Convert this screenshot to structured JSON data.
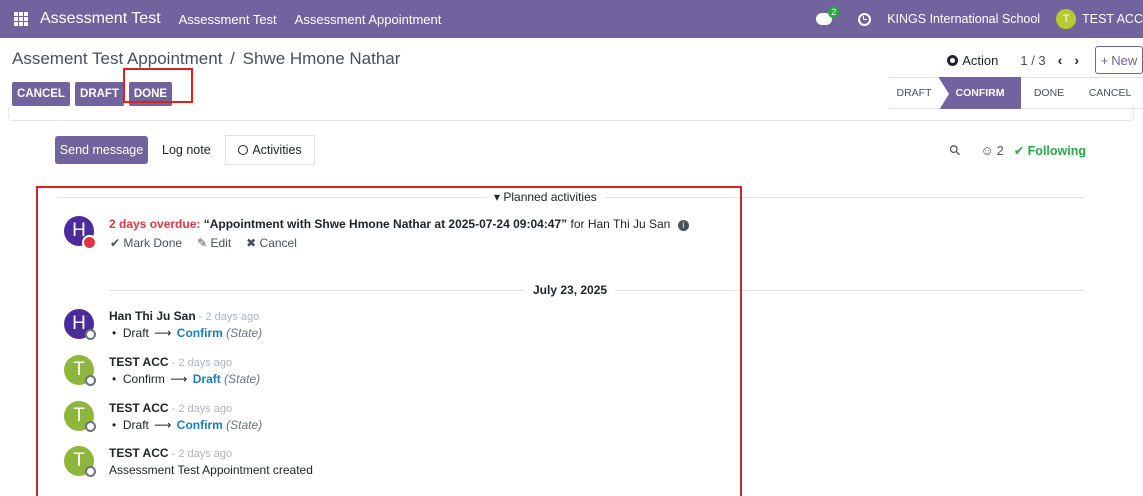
{
  "topbar": {
    "app_name": "Assessment Test",
    "menu": [
      "Assessment Test",
      "Assessment Appointment"
    ],
    "chat_count": "2",
    "company": "KINGS International School",
    "user_initial": "T",
    "user_name": "TEST ACC"
  },
  "breadcrumb": {
    "parent": "Assement Test Appointment",
    "separator": "/",
    "current": "Shwe Hmone Nathar"
  },
  "actions": {
    "action_label": "Action",
    "pager": "1 / 3",
    "prev": "‹",
    "next": "›",
    "new_label": "New"
  },
  "status_buttons": [
    "CANCEL",
    "DRAFT",
    "DONE"
  ],
  "stages": [
    "DRAFT",
    "CONFIRM",
    "DONE",
    "CANCEL"
  ],
  "active_stage": "CONFIRM",
  "chatter": {
    "send_message": "Send message",
    "log_note": "Log note",
    "activities": "Activities",
    "followers_count": "2",
    "following": "Following"
  },
  "planned": {
    "label": "Planned activities",
    "overdue": "2 days overdue:",
    "summary": "“Appointment with Shwe Hmone Nathar at 2025-07-24 09:04:47”",
    "for": "for Han Thi Ju San",
    "avatar": "H",
    "mark_done": "Mark Done",
    "edit": "Edit",
    "cancel": "Cancel"
  },
  "date_separator": "July 23, 2025",
  "messages": [
    {
      "avatar": "H",
      "author": "Han Thi Ju San",
      "meta": " - 2 days ago",
      "from": "Draft",
      "to": "Confirm",
      "field": "(State)"
    },
    {
      "avatar": "T",
      "author": "TEST ACC",
      "meta": " - 2 days ago",
      "from": "Confirm",
      "to": "Draft",
      "field": "(State)"
    },
    {
      "avatar": "T",
      "author": "TEST ACC",
      "meta": " - 2 days ago",
      "from": "Draft",
      "to": "Confirm",
      "field": "(State)"
    },
    {
      "avatar": "T",
      "author": "TEST ACC",
      "meta": " - 2 days ago",
      "text": "Assessment Test Appointment created"
    }
  ]
}
